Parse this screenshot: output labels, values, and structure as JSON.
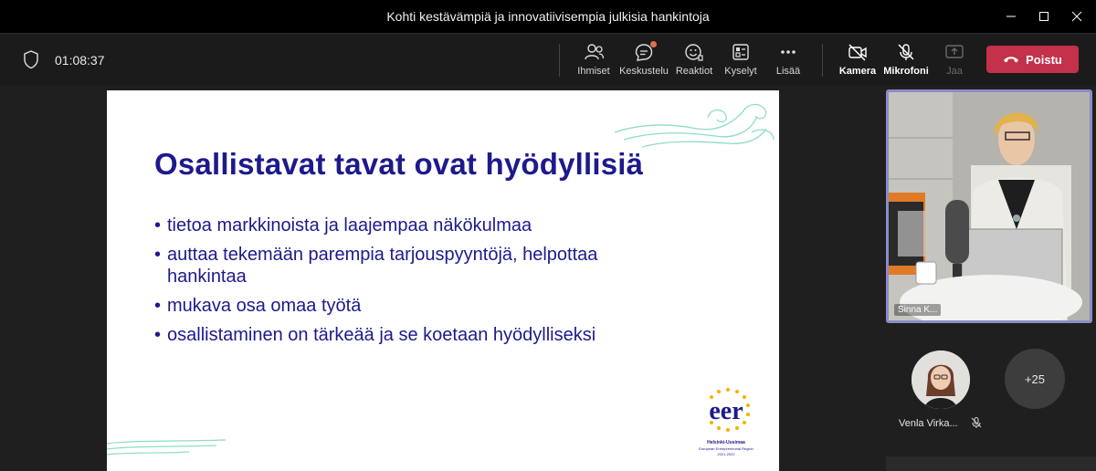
{
  "window": {
    "title": "Kohti kestävämpiä ja innovatiivisempia julkisia hankintoja"
  },
  "meeting": {
    "elapsed": "01:08:37",
    "toolbar": {
      "people": "Ihmiset",
      "chat": "Keskustelu",
      "reactions": "Reaktiot",
      "polls": "Kyselyt",
      "more": "Lisää",
      "camera": "Kamera",
      "mic": "Mikrofoni",
      "share": "Jaa",
      "leave": "Poistu"
    }
  },
  "slide": {
    "title": "Osallistavat tavat ovat hyödyllisiä",
    "bullets": [
      "tietoa markkinoista ja laajempaa näkökulmaa",
      "auttaa tekemään parempia tarjouspyyntöjä, helpottaa hankintaa",
      "mukava osa omaa työtä",
      "osallistaminen on tärkeää ja se koetaan hyödylliseksi"
    ],
    "logo": {
      "wordmark": "eer",
      "line1": "Helsinki-Uusimaa",
      "line2": "European Entrepreneurial Region",
      "line3": "2021-2022"
    },
    "colors": {
      "title": "#1d1a8c",
      "swirl": "#8fdcc8"
    }
  },
  "participants": {
    "speaker_name_partial": "Sinna K...",
    "attendee_name": "Venla Virka...",
    "overflow_count": "+25"
  },
  "colors": {
    "leave_button": "#c4314b",
    "speaker_border": "#8b8cc7"
  }
}
